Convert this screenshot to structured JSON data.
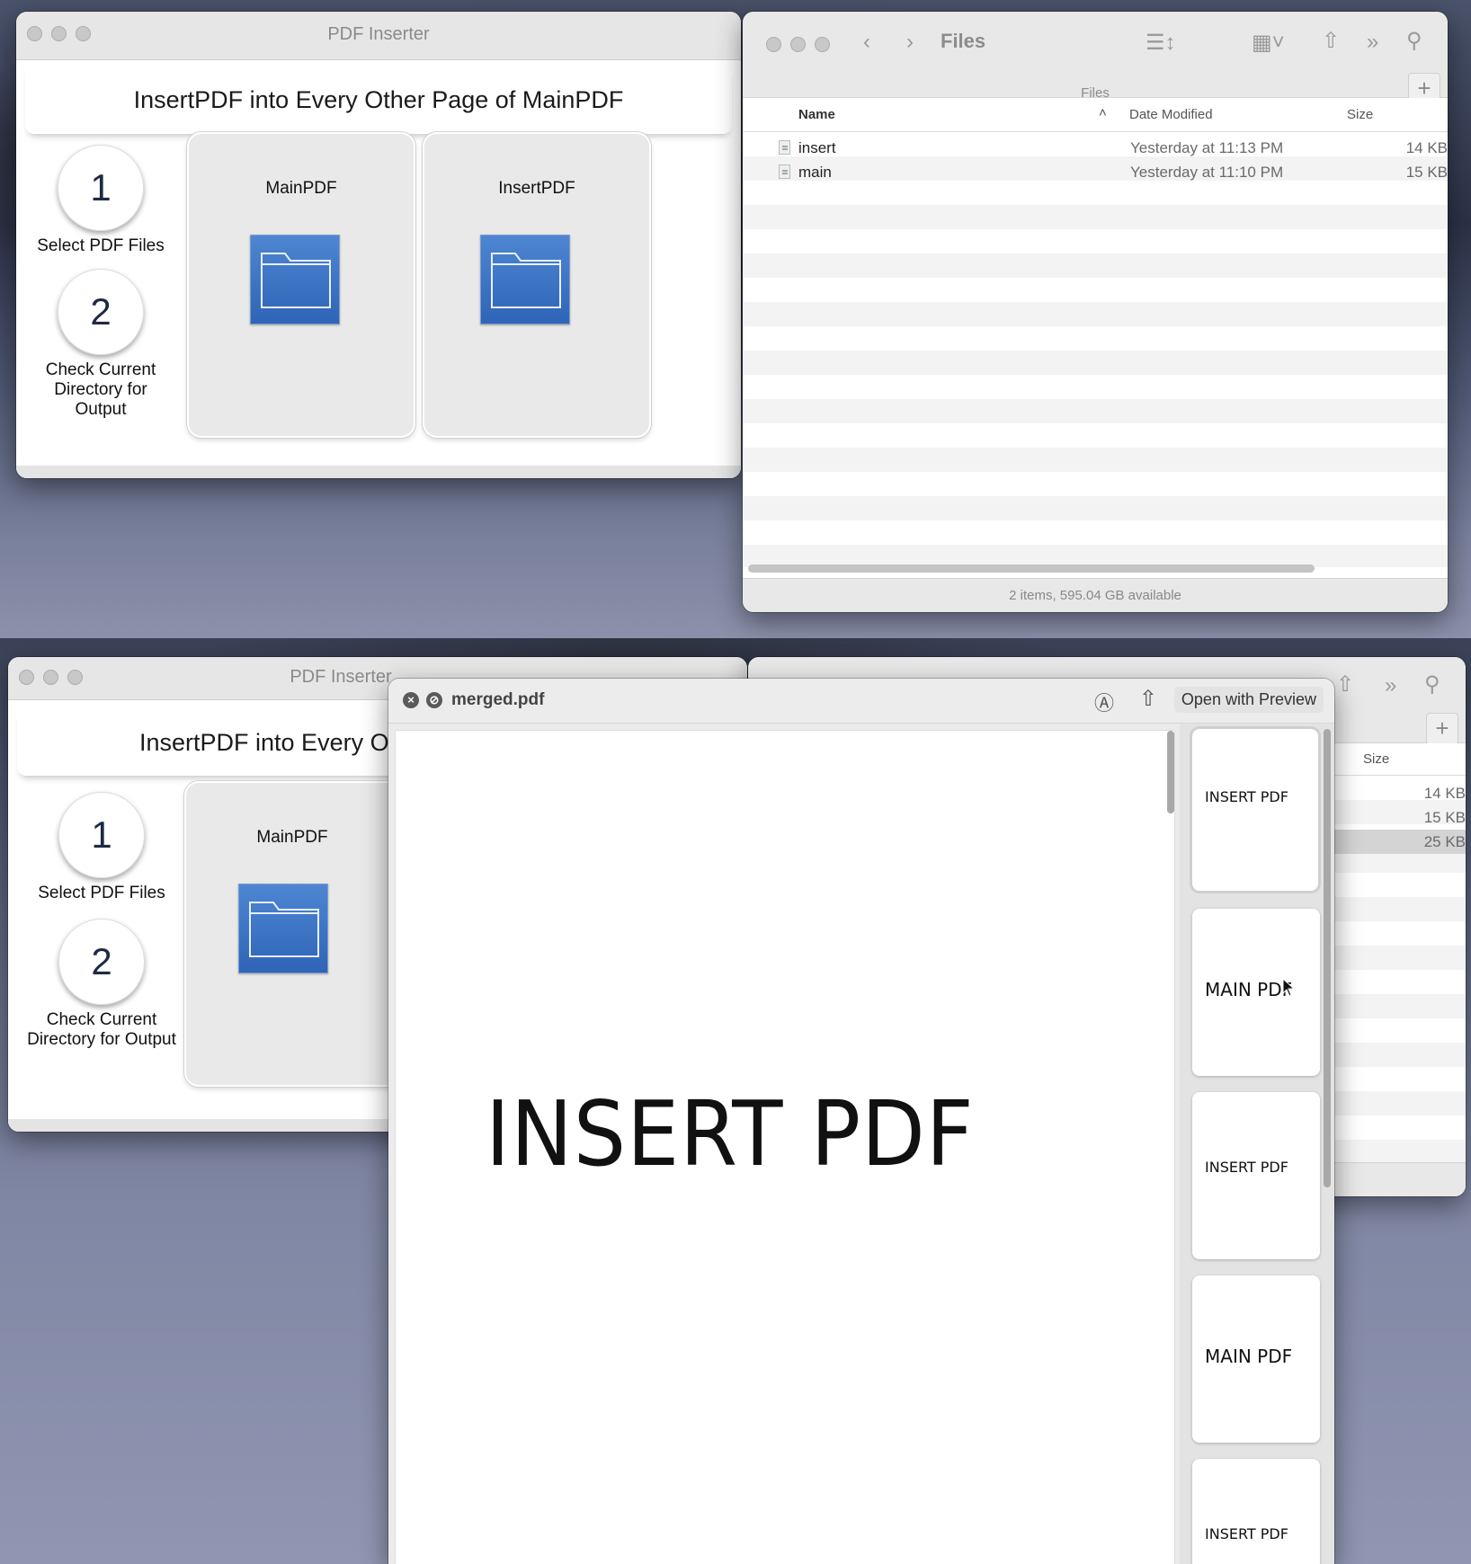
{
  "top": {
    "inserter": {
      "title": "PDF Inserter",
      "header": "InsertPDF into Every Other Page of MainPDF",
      "step1": {
        "number": "1",
        "label": "Select PDF Files"
      },
      "step2": {
        "number": "2",
        "label": "Check Current Directory for Output"
      },
      "main_box": "MainPDF",
      "insert_box": "InsertPDF"
    },
    "finder": {
      "title": "Files",
      "path": "Files",
      "columns": {
        "name": "Name",
        "date": "Date Modified",
        "size": "Size"
      },
      "files": [
        {
          "name": "insert",
          "date": "Yesterday at 11:13 PM",
          "size": "14 KB"
        },
        {
          "name": "main",
          "date": "Yesterday at 11:10 PM",
          "size": "15 KB"
        }
      ],
      "status": "2 items, 595.04 GB available"
    }
  },
  "bottom": {
    "inserter": {
      "title": "PDF Inserter",
      "header": "InsertPDF into Every Ot",
      "step1": {
        "number": "1",
        "label": "Select PDF Files"
      },
      "step2": {
        "number": "2",
        "label": "Check Current Directory for Output"
      },
      "main_box": "MainPDF"
    },
    "finder": {
      "size_header": "Size",
      "sizes": [
        "14 KB",
        "15 KB",
        "25 KB"
      ]
    },
    "quicklook": {
      "filename": "merged.pdf",
      "open_with": "Open with Preview",
      "page_text": "INSERT PDF",
      "thumbnails": [
        "INSERT PDF",
        "MAIN PDF",
        "INSERT PDF",
        "MAIN PDF",
        "INSERT PDF"
      ]
    }
  }
}
